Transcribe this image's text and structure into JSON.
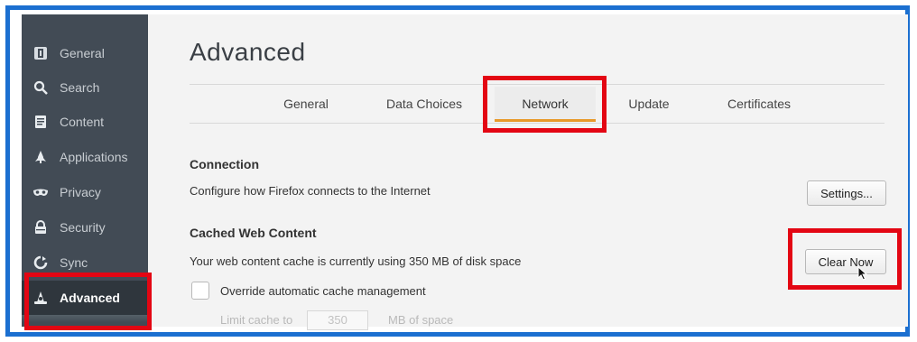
{
  "sidebar": {
    "items": [
      {
        "label": "General",
        "icon": "general-icon"
      },
      {
        "label": "Search",
        "icon": "search-icon"
      },
      {
        "label": "Content",
        "icon": "content-icon"
      },
      {
        "label": "Applications",
        "icon": "applications-icon"
      },
      {
        "label": "Privacy",
        "icon": "privacy-mask-icon"
      },
      {
        "label": "Security",
        "icon": "lock-icon"
      },
      {
        "label": "Sync",
        "icon": "sync-icon"
      },
      {
        "label": "Advanced",
        "icon": "wizard-hat-icon",
        "active": true
      }
    ]
  },
  "main": {
    "title": "Advanced",
    "tabs": [
      {
        "label": "General"
      },
      {
        "label": "Data Choices"
      },
      {
        "label": "Network",
        "selected": true
      },
      {
        "label": "Update"
      },
      {
        "label": "Certificates"
      }
    ],
    "connection": {
      "heading": "Connection",
      "description": "Configure how Firefox connects to the Internet",
      "settings_button": "Settings..."
    },
    "cache": {
      "heading": "Cached Web Content",
      "description": "Your web content cache is currently using 350 MB of disk space",
      "clear_button": "Clear Now",
      "override_label": "Override automatic cache management",
      "override_checked": false,
      "limit_label": "Limit cache to",
      "limit_value": "350",
      "limit_unit": "MB of space"
    }
  },
  "colors": {
    "frame_border": "#1b6fd0",
    "highlight": "#e30613",
    "sidebar_bg": "#424b55",
    "tab_underline": "#e8992a"
  }
}
